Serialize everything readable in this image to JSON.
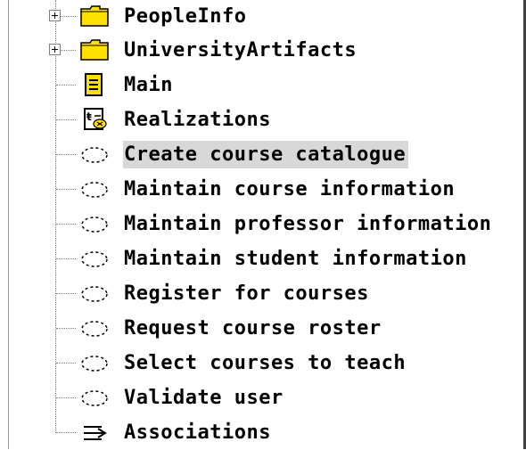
{
  "tree": {
    "items": [
      {
        "label": "PeopleInfo",
        "icon": "folder-icon",
        "expandable": true
      },
      {
        "label": "UniversityArtifacts",
        "icon": "folder-icon",
        "expandable": true
      },
      {
        "label": "Main",
        "icon": "diagram-icon",
        "expandable": false
      },
      {
        "label": "Realizations",
        "icon": "realization-diagram-icon",
        "expandable": false
      },
      {
        "label": "Create course catalogue",
        "icon": "use-case-icon",
        "expandable": false,
        "selected": true
      },
      {
        "label": "Maintain course information",
        "icon": "use-case-icon",
        "expandable": false
      },
      {
        "label": "Maintain professor information",
        "icon": "use-case-icon",
        "expandable": false
      },
      {
        "label": "Maintain student information",
        "icon": "use-case-icon",
        "expandable": false
      },
      {
        "label": "Register for courses",
        "icon": "use-case-icon",
        "expandable": false
      },
      {
        "label": "Request course roster",
        "icon": "use-case-icon",
        "expandable": false
      },
      {
        "label": "Select courses to teach",
        "icon": "use-case-icon",
        "expandable": false
      },
      {
        "label": "Validate user",
        "icon": "use-case-icon",
        "expandable": false
      },
      {
        "label": "Associations",
        "icon": "associations-icon",
        "expandable": false
      }
    ]
  },
  "colors": {
    "selection": "#d8d8d8",
    "folder": "#ffe000",
    "tree_line": "#808080"
  }
}
